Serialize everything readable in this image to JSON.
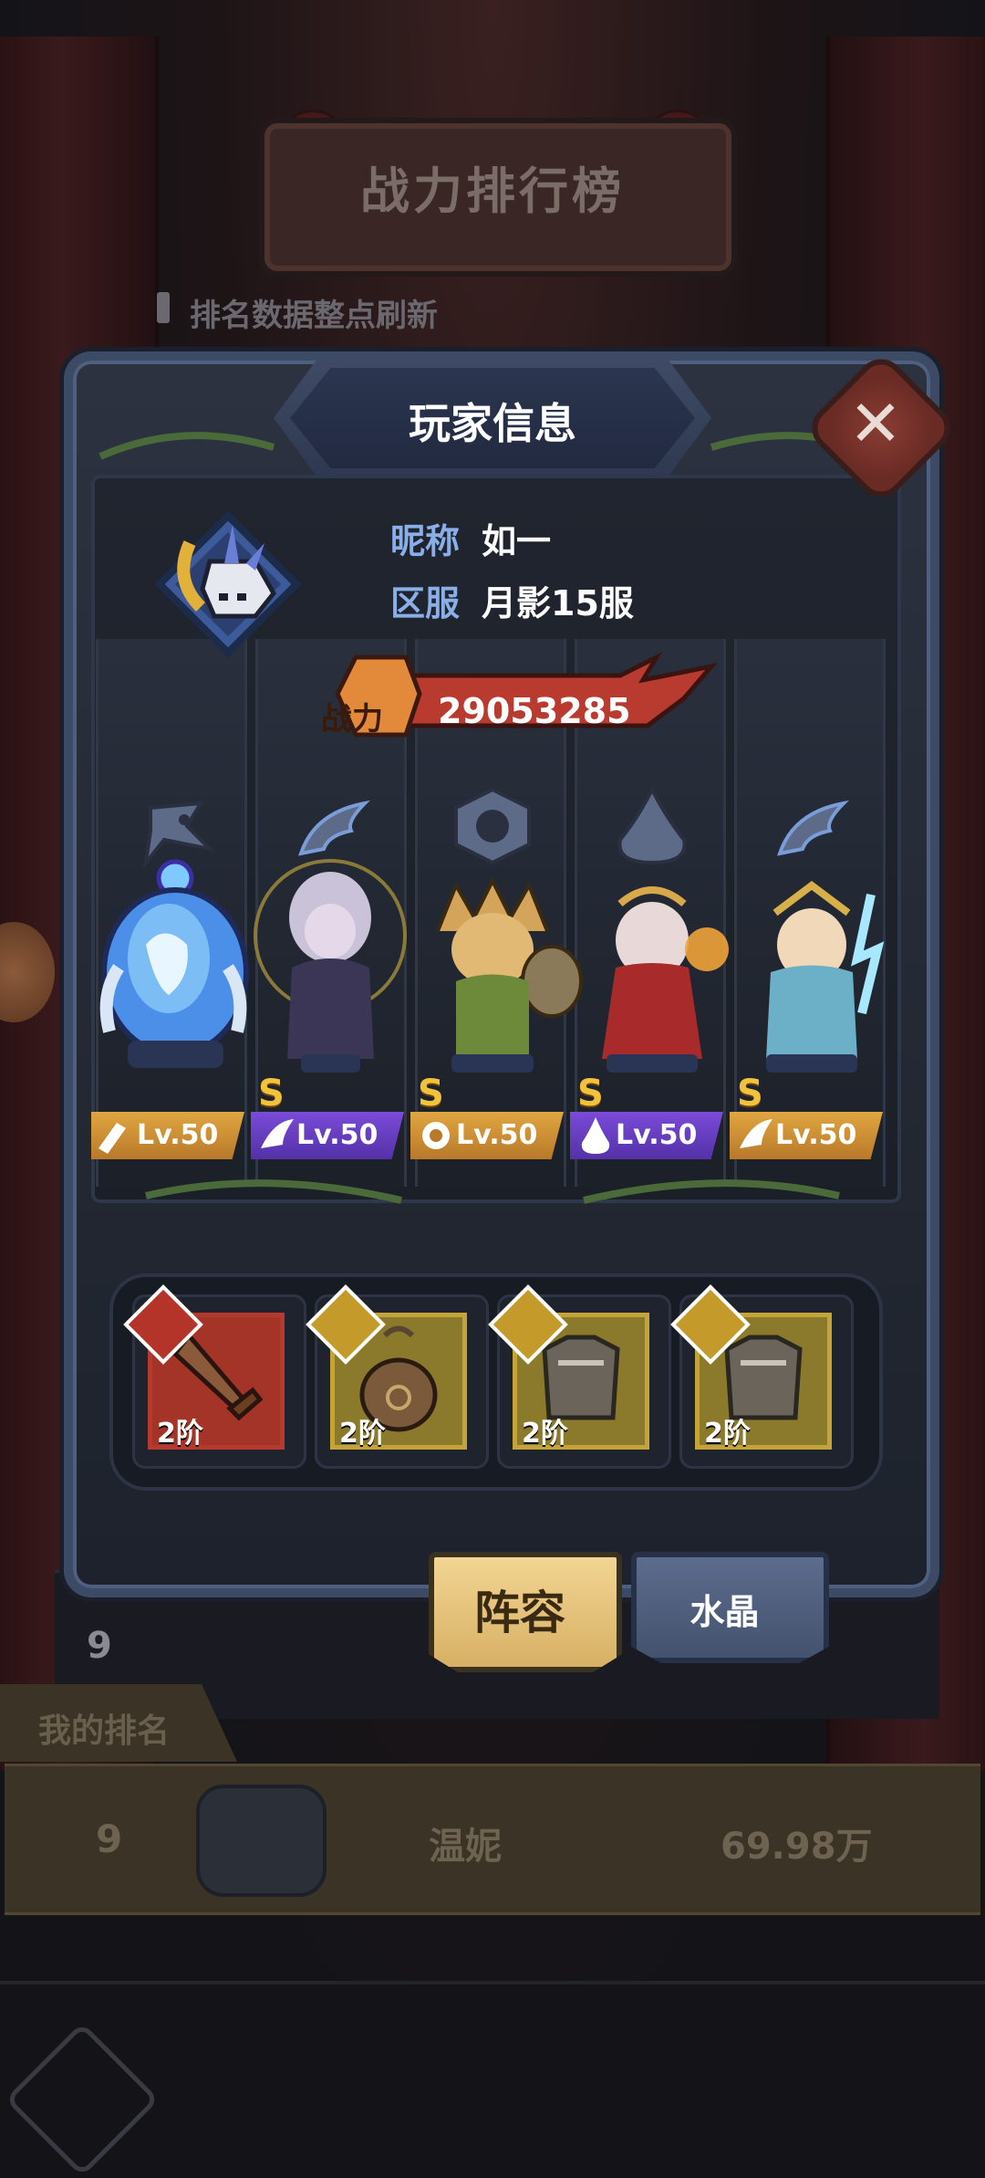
{
  "background": {
    "title": "战力排行榜",
    "notice": "排名数据整点刷新",
    "row_rank": "9",
    "my_rank": {
      "label": "我的排名",
      "rank": "9",
      "name": "温妮",
      "power": "69.98万"
    }
  },
  "modal": {
    "title": "玩家信息",
    "nickname_label": "昵称",
    "nickname": "如一",
    "server_label": "区服",
    "server": "月影15服",
    "power_label": "战力",
    "power": "29053285"
  },
  "heroes": [
    {
      "class_icon": "wrench-mask-icon",
      "grade": "",
      "level": "Lv.50",
      "level_color": "gold"
    },
    {
      "class_icon": "wing-icon",
      "grade": "S",
      "level": "Lv.50",
      "level_color": "purple"
    },
    {
      "class_icon": "beast-claw-icon",
      "grade": "S",
      "level": "Lv.50",
      "level_color": "gold"
    },
    {
      "class_icon": "flame-drop-icon",
      "grade": "S",
      "level": "Lv.50",
      "level_color": "purple"
    },
    {
      "class_icon": "wing-icon",
      "grade": "S",
      "level": "Lv.50",
      "level_color": "gold"
    }
  ],
  "equipment": [
    {
      "icon": "sword-icon",
      "tier": "2阶",
      "rarity": "red"
    },
    {
      "icon": "pouch-icon",
      "tier": "2阶",
      "rarity": "gold"
    },
    {
      "icon": "armor-icon",
      "tier": "2阶",
      "rarity": "gold"
    },
    {
      "icon": "armor-icon",
      "tier": "2阶",
      "rarity": "gold"
    }
  ],
  "tabs": {
    "active": "阵容",
    "inactive": "水晶"
  },
  "colors": {
    "label_blue": "#8aaee8",
    "level_gold": "#e0a640",
    "level_purple": "#7a4bd8",
    "power_red": "#b93a2e"
  }
}
